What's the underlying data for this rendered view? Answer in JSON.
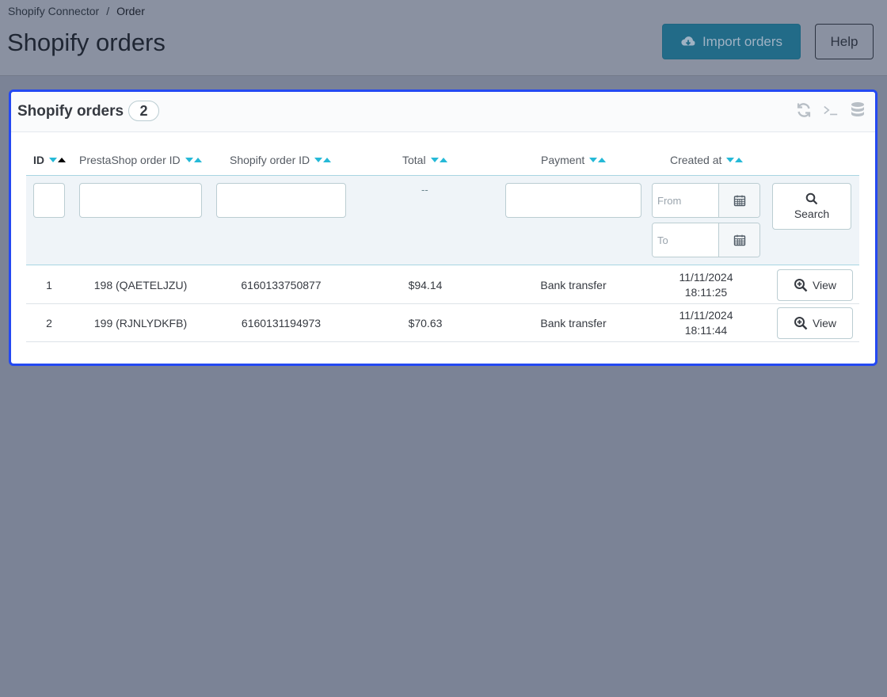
{
  "breadcrumb": {
    "parent": "Shopify Connector",
    "separator": "/",
    "current": "Order"
  },
  "page": {
    "title": "Shopify orders"
  },
  "toolbar": {
    "import_label": "Import orders",
    "help_label": "Help"
  },
  "panel": {
    "title": "Shopify orders",
    "count": "2",
    "header_icons": [
      "refresh-icon",
      "terminal-icon",
      "database-icon"
    ]
  },
  "table": {
    "columns": {
      "id": "ID",
      "prestashop_order_id": "PrestaShop order ID",
      "shopify_order_id": "Shopify order ID",
      "total": "Total",
      "payment": "Payment",
      "created_at": "Created at"
    },
    "filters": {
      "total_placeholder": "--",
      "date_from_placeholder": "From",
      "date_to_placeholder": "To",
      "search_label": "Search"
    },
    "rows": [
      {
        "id": "1",
        "prestashop_order_id": "198 (QAETELJZU)",
        "shopify_order_id": "6160133750877",
        "total": "$94.14",
        "payment": "Bank transfer",
        "date": "11/11/2024",
        "time": "18:11:25",
        "action": "View"
      },
      {
        "id": "2",
        "prestashop_order_id": "199 (RJNLYDKFB)",
        "shopify_order_id": "6160131194973",
        "total": "$70.63",
        "payment": "Bank transfer",
        "date": "11/11/2024",
        "time": "18:11:44",
        "action": "View"
      }
    ]
  },
  "colors": {
    "accent": "#25b9d7",
    "panel_border": "#2449f2",
    "overlay": "#7b8396"
  }
}
